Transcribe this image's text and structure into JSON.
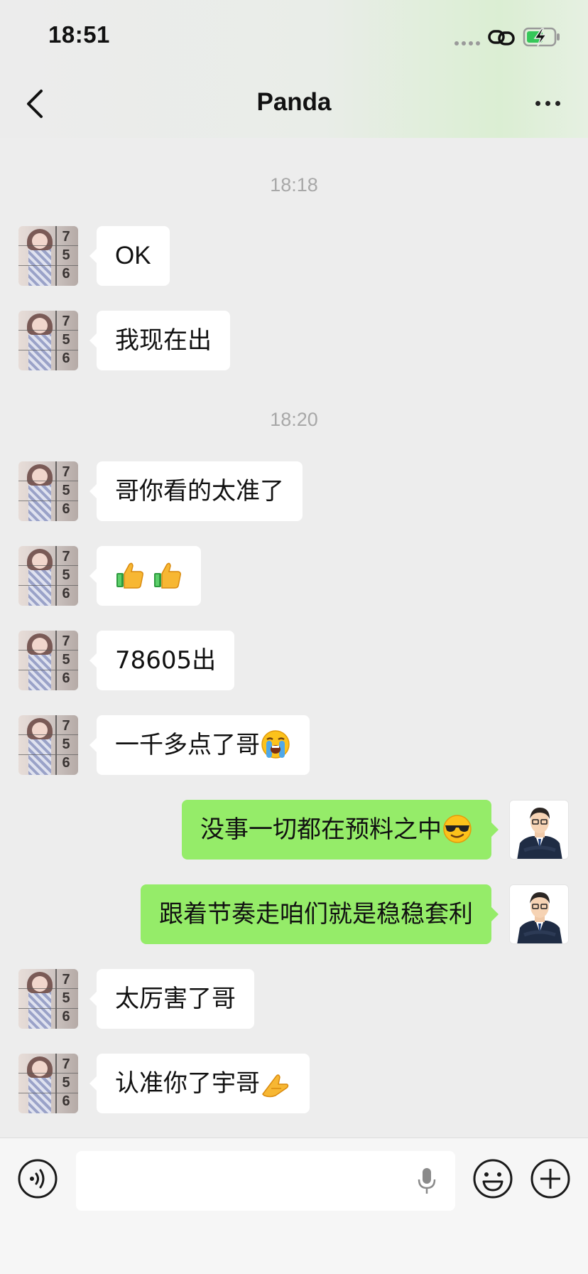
{
  "status_bar": {
    "time": "18:51"
  },
  "nav": {
    "title": "Panda"
  },
  "avatar_numbers": [
    "7",
    "5",
    "6"
  ],
  "messages": [
    {
      "type": "time",
      "text": "18:18"
    },
    {
      "type": "in",
      "text": "OK"
    },
    {
      "type": "in",
      "text": "我现在出"
    },
    {
      "type": "time",
      "text": "18:20"
    },
    {
      "type": "in",
      "text": "哥你看的太准了"
    },
    {
      "type": "in",
      "text": "",
      "emoji": [
        "thumbs-up",
        "thumbs-up"
      ]
    },
    {
      "type": "in",
      "text": "78605出"
    },
    {
      "type": "in",
      "text": "一千多点了哥",
      "emoji": [
        "loudly-crying-face"
      ]
    },
    {
      "type": "out",
      "text": "没事一切都在预料之中",
      "emoji": [
        "smiling-face-with-sunglasses"
      ]
    },
    {
      "type": "out",
      "text": "跟着节奏走咱们就是稳稳套利"
    },
    {
      "type": "in",
      "text": "太厉害了哥"
    },
    {
      "type": "in",
      "text": "认准你了宇哥",
      "emoji": [
        "folded-hands"
      ]
    }
  ],
  "input": {
    "value": "",
    "placeholder": ""
  },
  "colors": {
    "background": "#ededed",
    "incoming_bubble": "#ffffff",
    "outgoing_bubble": "#95ec69",
    "timestamp": "#a8a8a8"
  },
  "icons": [
    "back-icon",
    "more-icon",
    "voice-icon",
    "mic-icon",
    "emoji-icon",
    "plus-icon",
    "link-icon",
    "battery-icon"
  ]
}
